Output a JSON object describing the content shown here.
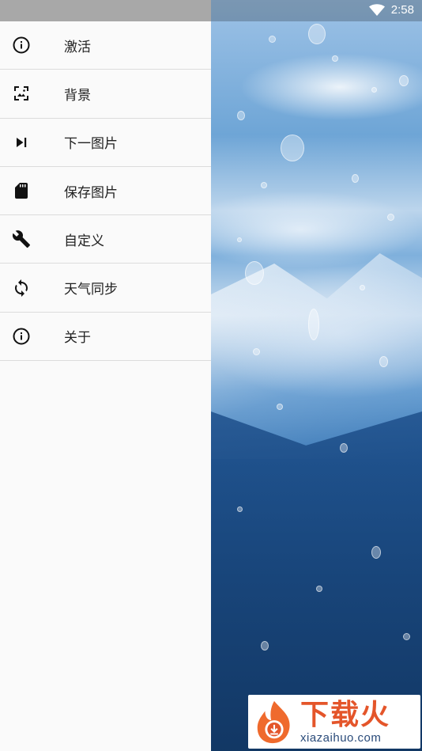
{
  "status_bar": {
    "time": "2:58"
  },
  "drawer": {
    "items": [
      {
        "label": "激活",
        "icon": "info-icon"
      },
      {
        "label": "背景",
        "icon": "wallpaper-icon"
      },
      {
        "label": "下一图片",
        "icon": "skip-next-icon"
      },
      {
        "label": "保存图片",
        "icon": "sd-card-icon"
      },
      {
        "label": "自定义",
        "icon": "wrench-icon"
      },
      {
        "label": "天气同步",
        "icon": "sync-icon"
      },
      {
        "label": "关于",
        "icon": "info-icon"
      }
    ]
  },
  "watermark": {
    "title": "下载火",
    "url": "xiazaihuo.com"
  },
  "colors": {
    "drawer_background": "#fafafa",
    "divider": "#dcdcdc",
    "watermark_accent": "#e4552a"
  }
}
